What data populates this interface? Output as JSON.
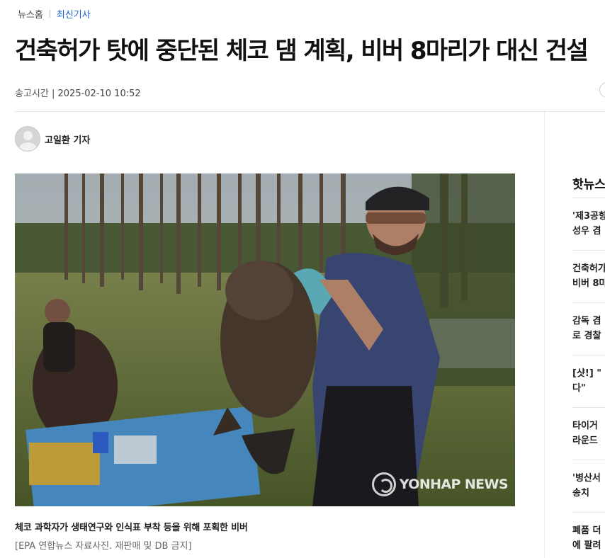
{
  "breadcrumb": {
    "home": "뉴스홈",
    "current": "최신기사"
  },
  "article": {
    "title": "건축허가 탓에 중단된 체코 댐 계획, 비버 8마리가 대신 건설",
    "published_label": "송고시간",
    "published_value": "2025-02-10 10:52",
    "author": "고일환 기자",
    "photo": {
      "caption": "체코 과학자가 생태연구와 인식표 부착 등을 위해 포획한 비버",
      "credit": "[EPA 연합뉴스 자료사진. 재판매 및 DB 금지]",
      "watermark": "YONHAP NEWS"
    }
  },
  "sidebar": {
    "title": "핫뉴스",
    "items": [
      {
        "line1": "'제3공항",
        "line2": "성우 겸"
      },
      {
        "line1": "건축허가",
        "line2": "비버 8마"
      },
      {
        "line1": "감독 겸",
        "line2": "로 경찰"
      },
      {
        "line1": "[샷!] \"",
        "line2": "다\""
      },
      {
        "line1": "타이거",
        "line2": "라운드"
      },
      {
        "line1": "'병산서",
        "line2": "송치"
      },
      {
        "line1": "폐품 더",
        "line2": "에 팔려"
      }
    ]
  }
}
